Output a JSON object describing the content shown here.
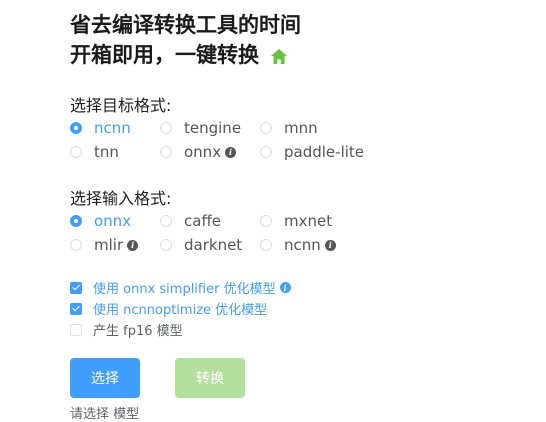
{
  "hero": {
    "line1": "省去编译转换工具的时间",
    "line2": "开箱即用，一键转换",
    "icon": "home-icon",
    "icon_color": "#67c23a"
  },
  "target_format": {
    "title": "选择目标格式:",
    "options": [
      {
        "label": "ncnn",
        "checked": true,
        "info": false
      },
      {
        "label": "tengine",
        "checked": false,
        "info": false
      },
      {
        "label": "mnn",
        "checked": false,
        "info": false
      },
      {
        "label": "tnn",
        "checked": false,
        "info": false
      },
      {
        "label": "onnx",
        "checked": false,
        "info": true
      },
      {
        "label": "paddle-lite",
        "checked": false,
        "info": false
      }
    ]
  },
  "input_format": {
    "title": "选择输入格式:",
    "options": [
      {
        "label": "onnx",
        "checked": true,
        "info": false
      },
      {
        "label": "caffe",
        "checked": false,
        "info": false
      },
      {
        "label": "mxnet",
        "checked": false,
        "info": false
      },
      {
        "label": "mlir",
        "checked": false,
        "info": true
      },
      {
        "label": "darknet",
        "checked": false,
        "info": false
      },
      {
        "label": "ncnn",
        "checked": false,
        "info": true
      }
    ]
  },
  "options": [
    {
      "label": "使用 onnx simplifier 优化模型",
      "checked": true,
      "info": true
    },
    {
      "label": "使用 ncnnoptimize 优化模型",
      "checked": true,
      "info": false
    },
    {
      "label": "产生 fp16 模型",
      "checked": false,
      "info": false
    }
  ],
  "buttons": {
    "select_label": "选择",
    "convert_label": "转换"
  },
  "bottom_hint": "请选择 模型",
  "colors": {
    "primary": "#409eff",
    "success_disabled": "#b3e19d",
    "text": "#606266"
  }
}
